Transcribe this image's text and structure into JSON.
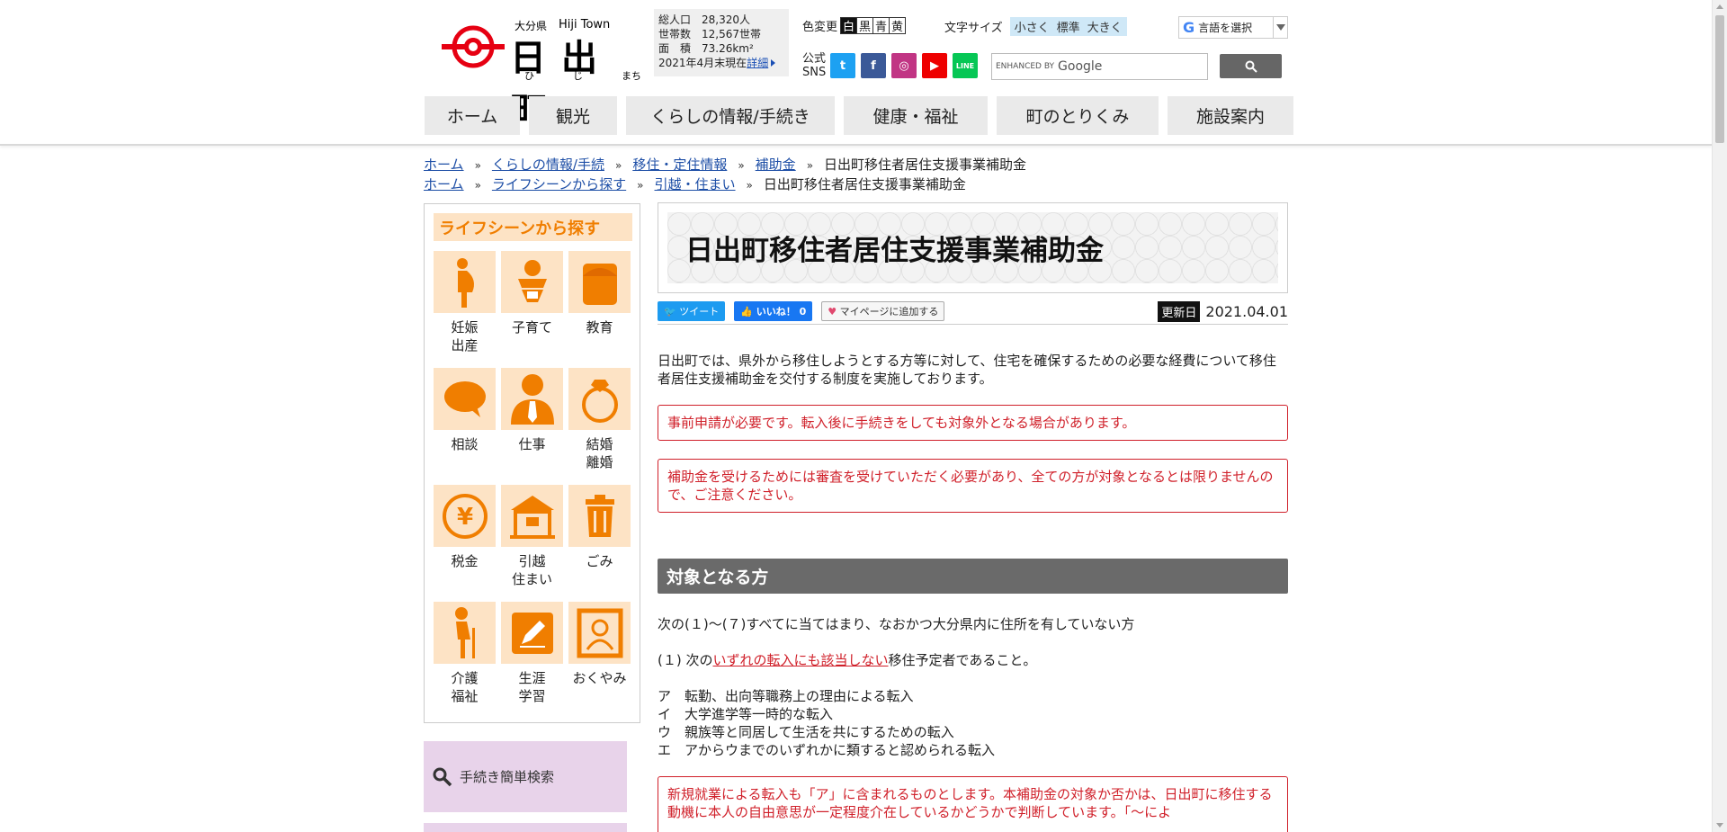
{
  "header": {
    "logo": {
      "pref": "大分県",
      "en": "Hiji Town",
      "name": "日出町",
      "kana": [
        "ひ",
        "じ",
        "まち"
      ]
    },
    "stats": {
      "rows": [
        {
          "label": "総人口",
          "value": "28,320人"
        },
        {
          "label": "世帯数",
          "value": "12,567世帯"
        },
        {
          "label": "面　積",
          "value": "73.26km²"
        }
      ],
      "asof": "2021年4月末現在",
      "detail_link": "詳細"
    },
    "color_change": {
      "label": "色変更",
      "options": [
        "白",
        "黒",
        "青",
        "黄"
      ]
    },
    "font_size": {
      "label": "文字サイズ",
      "options": [
        "小さく",
        "標準",
        "大きく"
      ]
    },
    "lang": {
      "g": "G",
      "label": "言語を選択"
    },
    "sns": {
      "label_line1": "公式",
      "label_line2": "SNS",
      "items": [
        {
          "name": "twitter",
          "glyph": "t",
          "color": "#1da1f2"
        },
        {
          "name": "facebook",
          "glyph": "f",
          "color": "#3b5998"
        },
        {
          "name": "instagram",
          "glyph": "◎",
          "color": "#c13584"
        },
        {
          "name": "youtube",
          "glyph": "▶",
          "color": "#e00"
        },
        {
          "name": "line",
          "glyph": "LINE",
          "color": "#06c755"
        }
      ]
    },
    "search": {
      "enhanced": "ENHANCED BY",
      "google": "Google"
    },
    "nav": [
      {
        "label": "ホーム"
      },
      {
        "label": "観光"
      },
      {
        "label": "くらしの情報/手続き"
      },
      {
        "label": "健康・福祉"
      },
      {
        "label": "町のとりくみ"
      },
      {
        "label": "施設案内"
      }
    ]
  },
  "breadcrumbs": [
    {
      "links": [
        "ホーム",
        "くらしの情報/手続",
        "移住・定住情報",
        "補助金"
      ],
      "current": "日出町移住者居住支援事業補助金"
    },
    {
      "links": [
        "ホーム",
        "ライフシーンから探す",
        "引越・住まい"
      ],
      "current": "日出町移住者居住支援事業補助金"
    }
  ],
  "sidebar": {
    "title": "ライフシーンから探す",
    "items": [
      {
        "label": "妊娠\n出産",
        "icon": "pregnancy-icon"
      },
      {
        "label": "子育て",
        "icon": "baby-icon"
      },
      {
        "label": "教育",
        "icon": "school-bag-icon"
      },
      {
        "label": "相談",
        "icon": "speech-bubble-icon"
      },
      {
        "label": "仕事",
        "icon": "businessman-icon"
      },
      {
        "label": "結婚\n離婚",
        "icon": "ring-icon"
      },
      {
        "label": "税金",
        "icon": "yen-icon"
      },
      {
        "label": "引越\n住まい",
        "icon": "house-icon"
      },
      {
        "label": "ごみ",
        "icon": "trash-icon"
      },
      {
        "label": "介護\n福祉",
        "icon": "elderly-icon"
      },
      {
        "label": "生涯\n学習",
        "icon": "pencil-icon"
      },
      {
        "label": "おくやみ",
        "icon": "portrait-icon"
      }
    ],
    "quick_search": "手続き簡単検索"
  },
  "main": {
    "title": "日出町移住者居住支援事業補助金",
    "share": {
      "tweet": "ツイート",
      "like": "いいね！ 0",
      "mypage": "マイページに追加する"
    },
    "updated": {
      "label": "更新日",
      "date": "2021.04.01"
    },
    "intro": "日出町では、県外から移住しようとする方等に対して、住宅を確保するための必要な経費について移住者居住支援補助金を交付する制度を実施しております。",
    "alert1": "事前申請が必要です。転入後に手続きをしても対象外となる場合があります。",
    "alert2": "補助金を受けるためには審査を受けていただく必要があり、全ての方が対象となるとは限りませんので、ご注意ください。",
    "section_title": "対象となる方",
    "cond_intro": "次の(１)～(７)すべてに当てはまり、なおかつ大分県内に住所を有していない方",
    "cond1_pre": "(１) 次の",
    "cond1_red": "いずれの転入にも該当しない",
    "cond1_post": "移住予定者であること。",
    "list": [
      {
        "k": "ア",
        "t": "転勤、出向等職務上の理由による転入"
      },
      {
        "k": "イ",
        "t": "大学進学等一時的な転入"
      },
      {
        "k": "ウ",
        "t": "親族等と同居して生活を共にするための転入"
      },
      {
        "k": "エ",
        "t": "アからウまでのいずれかに類すると認められる転入"
      }
    ],
    "alert3": "新規就業による転入も「ア」に含まれるものとします。本補助金の対象か否かは、日出町に移住する動機に本人の自由意思が一定程度介在しているかどうかで判断しています。「～によ"
  },
  "colors": {
    "accent_orange": "#f07e00",
    "life_bg": "#fde3c5",
    "alert_red": "#d0202a",
    "section_gray": "#6a6a6a",
    "logo_red": "#e60012"
  }
}
